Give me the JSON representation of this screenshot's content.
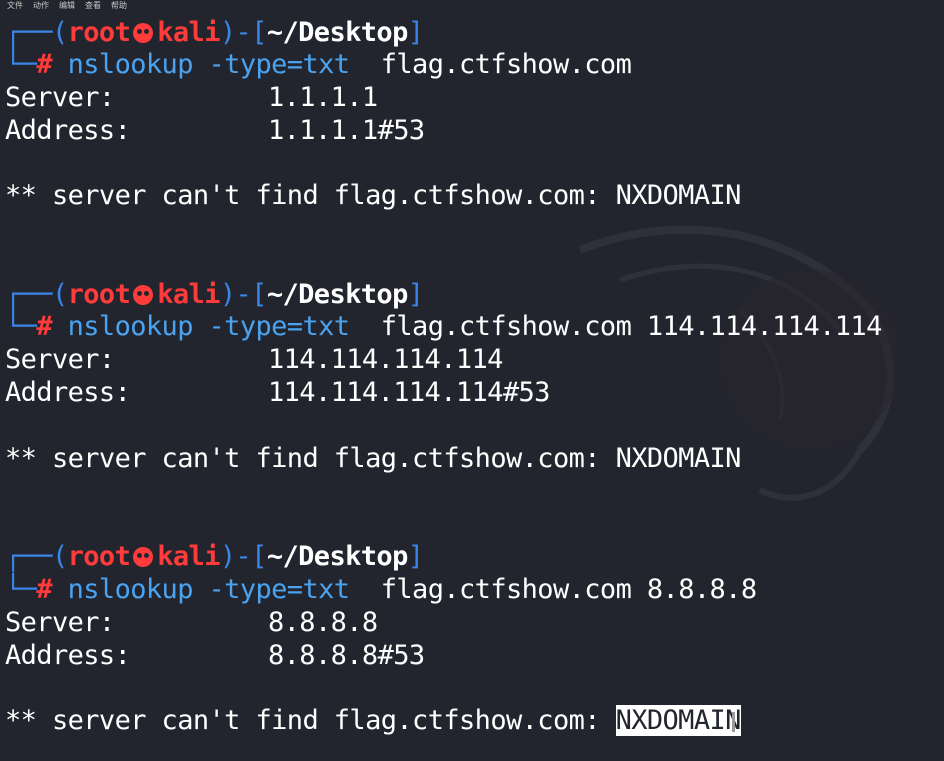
{
  "menu": [
    "文件",
    "动作",
    "编辑",
    "查看",
    "帮助"
  ],
  "prompt": {
    "frame_top": "┌──(",
    "user": "root",
    "host": "kali",
    "frame_mid": ")-[",
    "path": "~/Desktop",
    "frame_end": "]",
    "frame_bottom": "└─",
    "hash": "#"
  },
  "blocks": [
    {
      "command": "nslookup",
      "option": "-type=txt",
      "args": "  flag.ctfshow.com",
      "server_label": "Server:",
      "server_value": "1.1.1.1",
      "address_label": "Address:",
      "address_value": "1.1.1.1#53",
      "error_prefix": "** server can't find flag.ctfshow.com: ",
      "error_code": "NXDOMAIN"
    },
    {
      "command": "nslookup",
      "option": "-type=txt",
      "args": "  flag.ctfshow.com 114.114.114.114",
      "server_label": "Server:",
      "server_value": "114.114.114.114",
      "address_label": "Address:",
      "address_value": "114.114.114.114#53",
      "error_prefix": "** server can't find flag.ctfshow.com: ",
      "error_code": "NXDOMAIN"
    },
    {
      "command": "nslookup",
      "option": "-type=txt",
      "args": "  flag.ctfshow.com 8.8.8.8",
      "server_label": "Server:",
      "server_value": "8.8.8.8",
      "address_label": "Address:",
      "address_value": "8.8.8.8#53",
      "error_prefix": "** server can't find flag.ctfshow.com: ",
      "error_code": "NXDOMAIN"
    }
  ],
  "colors": {
    "background": "#23252e",
    "frame": "#3a86e8",
    "root": "#ff3b3b",
    "command": "#4aa3f0",
    "text": "#ffffff"
  }
}
